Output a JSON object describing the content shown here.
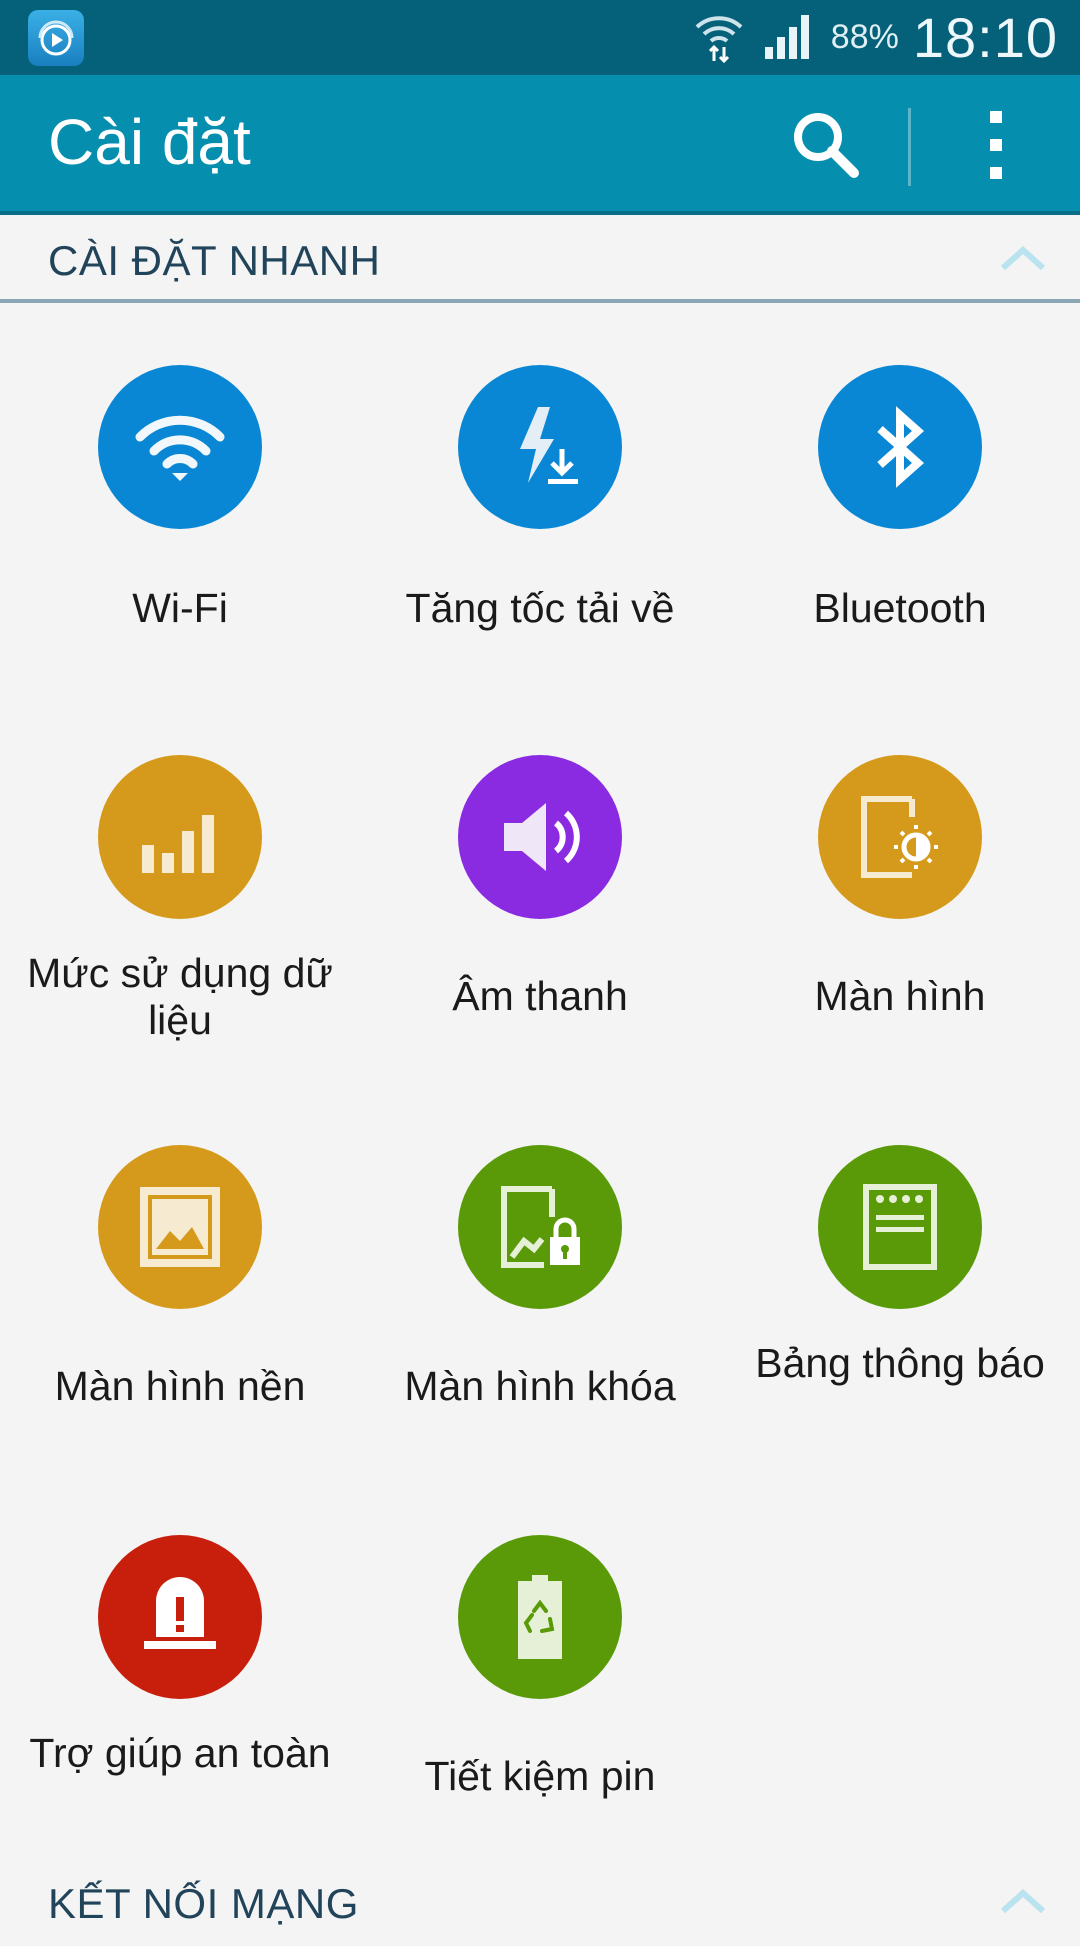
{
  "status_bar": {
    "battery": "88%",
    "time": "18:10"
  },
  "action_bar": {
    "title": "Cài đặt"
  },
  "sections": {
    "quick_settings": "CÀI ĐẶT NHANH",
    "network": "KẾT NỐI MẠNG"
  },
  "quick_items": [
    {
      "label": "Wi-Fi",
      "icon": "wifi-icon",
      "color": "#0a87d4"
    },
    {
      "label": "Tăng tốc tải về",
      "icon": "download-booster-icon",
      "color": "#0a87d4"
    },
    {
      "label": "Bluetooth",
      "icon": "bluetooth-icon",
      "color": "#0a87d4"
    },
    {
      "label": "Mức sử dụng dữ liệu",
      "icon": "data-usage-icon",
      "color": "#d59a1c"
    },
    {
      "label": "Âm thanh",
      "icon": "sound-icon",
      "color": "#8a2be2"
    },
    {
      "label": "Màn hình",
      "icon": "display-icon",
      "color": "#d59a1c"
    },
    {
      "label": "Màn hình nền",
      "icon": "wallpaper-icon",
      "color": "#d59a1c"
    },
    {
      "label": "Màn hình khóa",
      "icon": "lock-screen-icon",
      "color": "#5a9a09"
    },
    {
      "label": "Bảng thông báo",
      "icon": "notification-panel-icon",
      "color": "#5a9a09"
    },
    {
      "label": "Trợ giúp an toàn",
      "icon": "safety-assistance-icon",
      "color": "#c81f0c"
    },
    {
      "label": "Tiết kiệm pin",
      "icon": "power-saving-icon",
      "color": "#5a9a09"
    }
  ]
}
